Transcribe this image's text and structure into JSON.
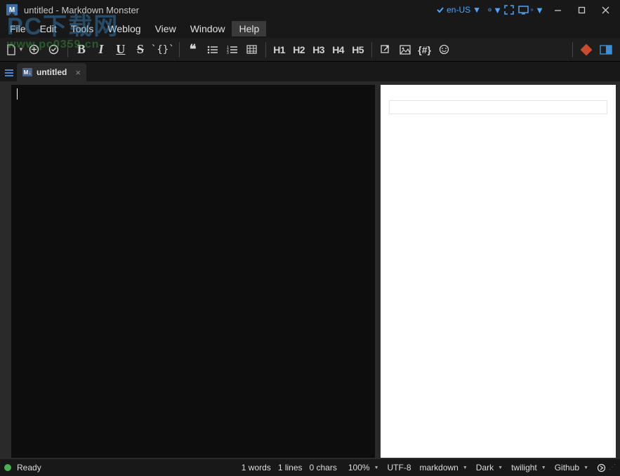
{
  "title": "untitled  - Markdown Monster",
  "language": "en-US",
  "menus": [
    "File",
    "Edit",
    "Tools",
    "Weblog",
    "View",
    "Window",
    "Help"
  ],
  "active_menu": "Help",
  "headings": [
    "H1",
    "H2",
    "H3",
    "H4",
    "H5"
  ],
  "tab": {
    "label": "untitled",
    "icon_text": "M↓"
  },
  "status": {
    "state": "Ready",
    "words": "1 words",
    "lines": "1 lines",
    "chars": "0 chars",
    "zoom": "100%",
    "encoding": "UTF-8",
    "mode": "markdown",
    "app_theme": "Dark",
    "editor_theme": "twilight",
    "preview_theme": "Github"
  },
  "watermark": {
    "main": "PC下载网",
    "url": "www.pc0359.cn"
  }
}
